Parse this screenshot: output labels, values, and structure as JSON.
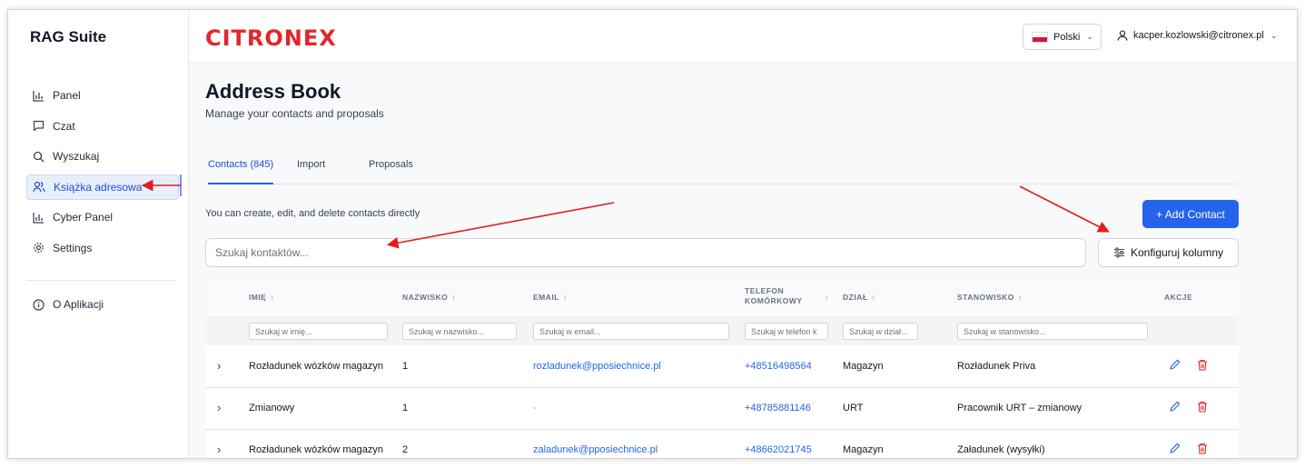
{
  "sidebar": {
    "brand": "RAG Suite",
    "items": [
      {
        "label": "Panel",
        "icon": "bar-chart-icon"
      },
      {
        "label": "Czat",
        "icon": "chat-icon"
      },
      {
        "label": "Wyszukaj",
        "icon": "search-icon"
      },
      {
        "label": "Książka adresowa",
        "icon": "users-icon"
      },
      {
        "label": "Cyber Panel",
        "icon": "bar-chart-icon"
      },
      {
        "label": "Settings",
        "icon": "gear-icon"
      }
    ],
    "about": {
      "label": "O Aplikacji",
      "icon": "info-icon"
    }
  },
  "header": {
    "logo": "CITRONEX",
    "language": "Polski",
    "user_email": "kacper.kozlowski@citronex.pl"
  },
  "page": {
    "title": "Address Book",
    "subtitle": "Manage your contacts and proposals",
    "tabs": [
      "Contacts (845)",
      "Import",
      "Proposals"
    ],
    "hint": "You can create, edit, and delete contacts directly",
    "add_contact_label": "+ Add Contact",
    "search_placeholder": "Szukaj kontaktów...",
    "configure_columns_label": "Konfiguruj kolumny"
  },
  "table": {
    "columns": [
      "IMIĘ",
      "NAZWISKO",
      "EMAIL",
      "TELEFON KOMÓRKOWY",
      "DZIAŁ",
      "STANOWISKO",
      "AKCJE"
    ],
    "telefon_line1": "TELEFON",
    "telefon_line2": "KOMÓRKOWY",
    "sort_glyph": "↕",
    "filters": [
      "Szukaj w imię...",
      "Szukaj w nazwisko...",
      "Szukaj w email...",
      "Szukaj w telefon k",
      "Szukaj w dział...",
      "Szukaj w stanowisko..."
    ],
    "rows": [
      {
        "imie": "Rozładunek wózków magazyn",
        "nazwisko": "1",
        "email": "rozladunek@pposiechnice.pl",
        "telefon": "+48516498564",
        "dzial": "Magazyn",
        "stanowisko": "Rozładunek Priva"
      },
      {
        "imie": "Zmianowy",
        "nazwisko": "1",
        "email": "-",
        "telefon": "+48785881146",
        "dzial": "URT",
        "stanowisko": "Pracownik URT – zmianowy"
      },
      {
        "imie": "Rozładunek wózków magazyn",
        "nazwisko": "2",
        "email": "zaladunek@pposiechnice.pl",
        "telefon": "+48662021745",
        "dzial": "Magazyn",
        "stanowisko": "Załadunek (wysyłki)"
      }
    ]
  },
  "colors": {
    "accent": "#2563eb",
    "logo": "#e3262a",
    "delete": "#dc2626",
    "annotation_arrow": "#e11d1d"
  }
}
